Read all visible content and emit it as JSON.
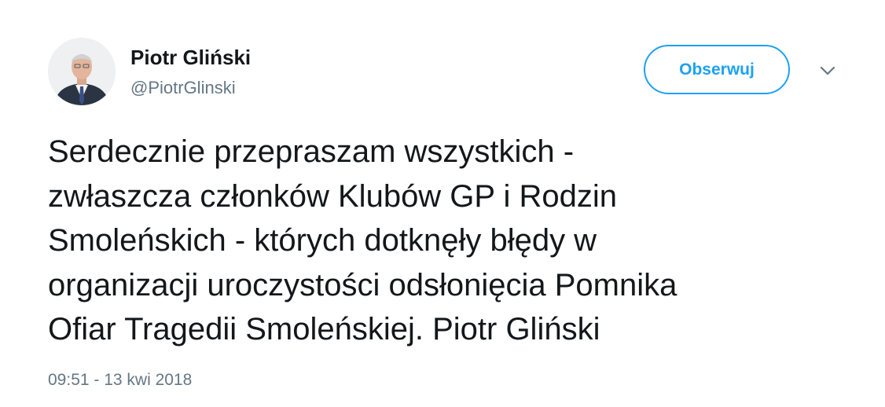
{
  "tweet": {
    "author": {
      "display_name": "Piotr Gliński",
      "handle": "@PiotrGlinski"
    },
    "follow_button_label": "Obserwuj",
    "text_lines": [
      "Serdecznie przepraszam wszystkich -",
      "zwłaszcza członków Klubów GP i Rodzin",
      "Smoleńskich - których dotknęły błędy w",
      "organizacji uroczystości odsłonięcia Pomnika",
      "Ofiar Tragedii Smoleńskiej. Piotr Gliński"
    ],
    "timestamp": "09:51 - 13 kwi 2018"
  },
  "colors": {
    "accent": "#1da1f2",
    "text_primary": "#14171a",
    "text_secondary": "#657786"
  },
  "icons": {
    "caret": "chevron-down-icon"
  }
}
